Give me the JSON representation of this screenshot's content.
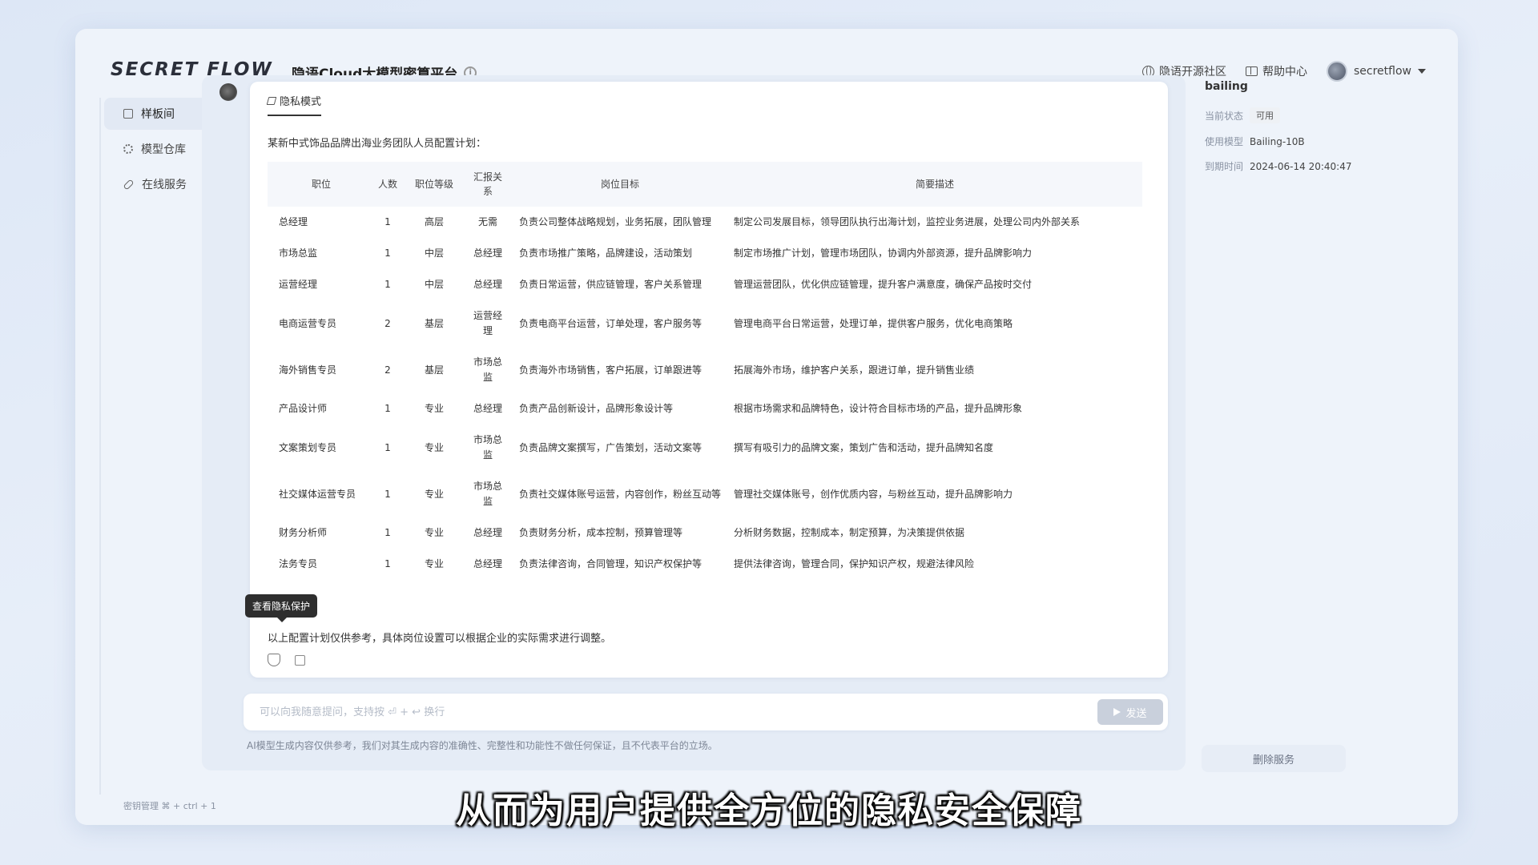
{
  "header": {
    "logo": "SECRET FLOW",
    "platform_title": "隐语Cloud大模型密算平台",
    "links": [
      {
        "label": "隐语开源社区",
        "icon": "globe-icon"
      },
      {
        "label": "帮助中心",
        "icon": "book-icon"
      }
    ],
    "username": "secretflow"
  },
  "sidebar": {
    "items": [
      {
        "label": "样板间",
        "active": true
      },
      {
        "label": "模型仓库",
        "active": false
      },
      {
        "label": "在线服务",
        "active": false
      }
    ],
    "bottom_text": "密钥管理  ⌘ + ctrl + 1"
  },
  "chat": {
    "mode_tab": "隐私模式",
    "intro": "某新中式饰品品牌出海业务团队人员配置计划：",
    "columns": [
      "职位",
      "人数",
      "职位等级",
      "汇报关系",
      "岗位目标",
      "简要描述"
    ],
    "rows": [
      [
        "总经理",
        "1",
        "高层",
        "无需",
        "负责公司整体战略规划，业务拓展，团队管理",
        "制定公司发展目标，领导团队执行出海计划，监控业务进展，处理公司内外部关系"
      ],
      [
        "市场总监",
        "1",
        "中层",
        "总经理",
        "负责市场推广策略，品牌建设，活动策划",
        "制定市场推广计划，管理市场团队，协调内外部资源，提升品牌影响力"
      ],
      [
        "运营经理",
        "1",
        "中层",
        "总经理",
        "负责日常运营，供应链管理，客户关系管理",
        "管理运营团队，优化供应链管理，提升客户满意度，确保产品按时交付"
      ],
      [
        "电商运营专员",
        "2",
        "基层",
        "运营经理",
        "负责电商平台运营，订单处理，客户服务等",
        "管理电商平台日常运营，处理订单，提供客户服务，优化电商策略"
      ],
      [
        "海外销售专员",
        "2",
        "基层",
        "市场总监",
        "负责海外市场销售，客户拓展，订单跟进等",
        "拓展海外市场，维护客户关系，跟进订单，提升销售业绩"
      ],
      [
        "产品设计师",
        "1",
        "专业",
        "总经理",
        "负责产品创新设计，品牌形象设计等",
        "根据市场需求和品牌特色，设计符合目标市场的产品，提升品牌形象"
      ],
      [
        "文案策划专员",
        "1",
        "专业",
        "市场总监",
        "负责品牌文案撰写，广告策划，活动文案等",
        "撰写有吸引力的品牌文案，策划广告和活动，提升品牌知名度"
      ],
      [
        "社交媒体运营专员",
        "1",
        "专业",
        "市场总监",
        "负责社交媒体账号运营，内容创作，粉丝互动等",
        "管理社交媒体账号，创作优质内容，与粉丝互动，提升品牌影响力"
      ],
      [
        "财务分析师",
        "1",
        "专业",
        "总经理",
        "负责财务分析，成本控制，预算管理等",
        "分析财务数据，控制成本，制定预算，为决策提供依据"
      ],
      [
        "法务专员",
        "1",
        "专业",
        "总经理",
        "负责法律咨询，合同管理，知识产权保护等",
        "提供法律咨询，管理合同，保护知识产权，规避法律风险"
      ]
    ],
    "footer_note": "以上配置计划仅供参考，具体岗位设置可以根据企业的实际需求进行调整。",
    "tooltip": "查看隐私保护"
  },
  "input": {
    "placeholder": "可以向我随意提问，支持按 ⏎ + ↩ 换行",
    "send_label": "发送"
  },
  "disclaimer": "AI模型生成内容仅供参考，我们对其生成内容的准确性、完整性和功能性不做任何保证，且不代表平台的立场。",
  "right_panel": {
    "title": "bailing",
    "status_label": "当前状态",
    "status_value": "可用",
    "model_label": "使用模型",
    "model_value": "Bailing-10B",
    "expire_label": "到期时间",
    "expire_value": "2024-06-14 20:40:47",
    "delete_label": "删除服务"
  },
  "subtitle": "从而为用户提供全方位的隐私安全保障"
}
